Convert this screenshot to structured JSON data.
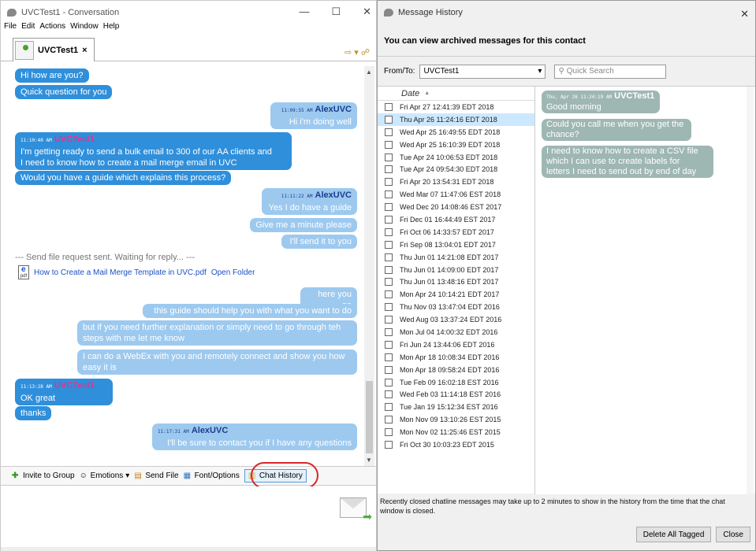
{
  "conv": {
    "title": "UVCTest1 - Conversation",
    "menu": [
      "File",
      "Edit",
      "Actions",
      "Window",
      "Help"
    ],
    "tab_label": "UVCTest1",
    "tab_close": "×",
    "messages": {
      "m1": "Hi how are you?",
      "m2": "Quick question for you",
      "m3_time": "11:09:55 AM",
      "m3_who": "AlexUVC",
      "m3_text": "Hi i'm doing well",
      "m4_time": "11:10:40 AM",
      "m4_who": "UVCTest1",
      "m4_line1": "I'm getting ready to send a bulk email to 300 of our AA clients and",
      "m4_line2": "I need to know how to create a mail merge email in UVC",
      "m5": "Would you have a guide which explains this process?",
      "m6_time": "11:11:22 AM",
      "m6_who": "AlexUVC",
      "m6_text": "Yes I do have a guide",
      "m7": "Give me a minute please",
      "m8": "I'll send it to you",
      "sys": "--- Send file request sent. Waiting for reply... ---",
      "file_name": "How to Create a Mail Merge Template in UVC.pdf",
      "file_action": "Open Folder",
      "file_icon_label": "pdf",
      "m9": "here you go",
      "m10": "this guide should help you with what you want to do",
      "m11_line1": "but if you need further explanation or simply need to go through teh",
      "m11_line2": "steps with me let me know",
      "m12_line1": "I can do a WebEx with you and remotely connect and show you how",
      "m12_line2": "easy it is",
      "m13_time": "11:13:28 AM",
      "m13_who": "UVCTest1",
      "m13_text": "OK great",
      "m14": "thanks",
      "m15_time": "11:17:31 AM",
      "m15_who": "AlexUVC",
      "m15_text": "I'll be sure to contact  you if I have any questions"
    },
    "toolbar": {
      "invite": "Invite to Group",
      "emotions": "Emotions",
      "send_file": "Send File",
      "font": "Font/Options",
      "history": "Chat History"
    }
  },
  "history": {
    "title": "Message History",
    "header": "You can view archived messages for this contact",
    "from_label": "From/To:",
    "from_value": "UVCTest1",
    "search_placeholder": "Quick Search",
    "col_date": "Date",
    "dates": [
      "Fri Apr 27 12:41:39 EDT 2018",
      "Thu Apr 26 11:24:16 EDT 2018",
      "Wed Apr 25 16:49:55 EDT 2018",
      "Wed Apr 25 16:10:39 EDT 2018",
      "Tue Apr 24 10:06:53 EDT 2018",
      "Tue Apr 24 09:54:30 EDT 2018",
      "Fri Apr 20 13:54:31 EDT 2018",
      "Wed Mar 07 11:47:06 EST 2018",
      "Wed Dec 20 14:08:46 EST 2017",
      "Fri Dec 01 16:44:49 EST 2017",
      "Fri Oct 06 14:33:57 EDT 2017",
      "Fri Sep 08 13:04:01 EDT 2017",
      "Thu Jun 01 14:21:08 EDT 2017",
      "Thu Jun 01 14:09:00 EDT 2017",
      "Thu Jun 01 13:48:16 EDT 2017",
      "Mon Apr 24 10:14:21 EDT 2017",
      "Thu Nov 03 13:47:04 EDT 2016",
      "Wed Aug 03 13:37:24 EDT 2016",
      "Mon Jul 04 14:00:32 EDT 2016",
      "Fri Jun 24 13:44:06 EDT 2016",
      "Mon Apr 18 10:08:34 EDT 2016",
      "Mon Apr 18 09:58:24 EDT 2016",
      "Tue Feb 09 16:02:18 EST 2016",
      "Wed Feb 03 11:14:18 EST 2016",
      "Tue Jan 19 15:12:34 EST 2016",
      "Mon Nov 09 13:10:26 EST 2015",
      "Mon Nov 02 11:25:46 EST 2015",
      "Fri Oct 30 10:03:23 EDT 2015"
    ],
    "preview": {
      "p1_time": "Thu, Apr 26 11:24:19 AM",
      "p1_who": "UVCTest1",
      "p1_text": "Good morning",
      "p2_line1": "Could you call me when you get the",
      "p2_line2": "chance?",
      "p3_line1": "I need to know how to create a CSV file",
      "p3_line2": "which I can use to create labels for",
      "p3_line3": "letters I need to send out by end of day"
    },
    "footer_line1": "Recently closed chatline messages may take up to 2 minutes to show in the history from the time that the chat",
    "footer_line2": "window is closed.",
    "btn_delete": "Delete All Tagged",
    "btn_close": "Close"
  },
  "colors": {
    "incoming": "#2f8fdb",
    "outgoing": "#9dc9ef",
    "highlight_circle": "#d9252a",
    "preview_bubble": "#9fb7b3"
  }
}
